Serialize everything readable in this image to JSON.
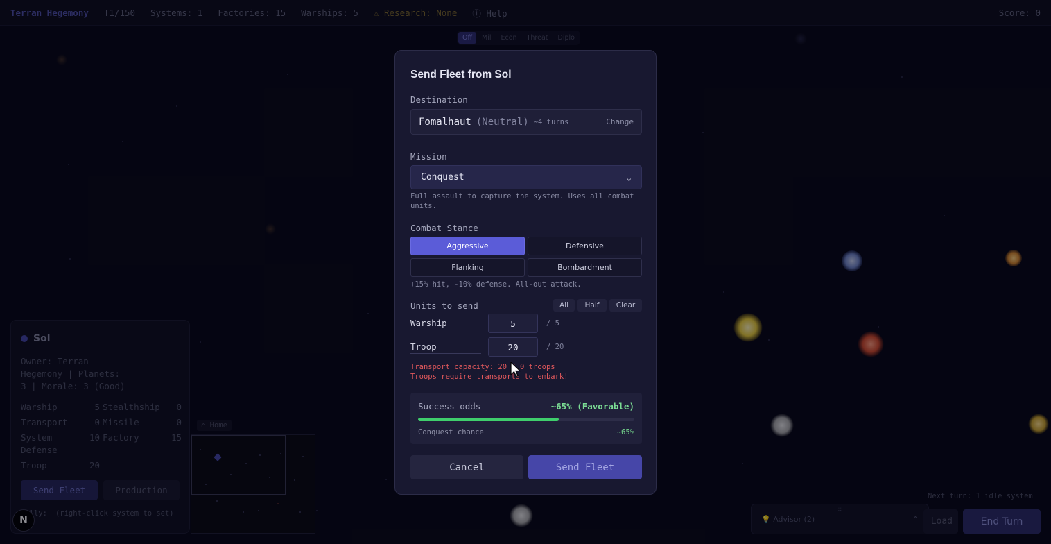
{
  "topbar": {
    "brand": "Terran Hegemony",
    "turn": "T1/150",
    "systems": "Systems: 1",
    "factories": "Factories: 15",
    "warships": "Warships: 5",
    "research": "⚠ Research: None",
    "help": "ⓘ Help",
    "score": "Score: 0"
  },
  "overlay_tabs": [
    "Off",
    "Mil",
    "Econ",
    "Threat",
    "Diplo"
  ],
  "system_panel": {
    "name": "Sol",
    "owner_line1": "Owner: Terran",
    "owner_line2": "Hegemony | Planets:",
    "owner_line3": "3 | Morale: 3 (Good)",
    "stats": [
      {
        "label": "Warship",
        "value": "5"
      },
      {
        "label": "Stealthship",
        "value": "0"
      },
      {
        "label": "Transport",
        "value": "0"
      },
      {
        "label": "Missile",
        "value": "0"
      },
      {
        "label": "System Defense",
        "value": "10"
      },
      {
        "label": "Factory",
        "value": "15"
      },
      {
        "label": "Troop",
        "value": "20"
      }
    ],
    "send_fleet": "Send Fleet",
    "production": "Production",
    "rally_label": "Rally:",
    "rally_value": "(right-click system to set)"
  },
  "minimap": {
    "home": "⌂ Home"
  },
  "bottom": {
    "next_turn": "Next turn: 1 idle system",
    "advisor": "💡 Advisor (2)",
    "load": "Load",
    "end_turn": "End Turn"
  },
  "modal": {
    "title": "Send Fleet from Sol",
    "destination_label": "Destination",
    "destination_name": "Fomalhaut",
    "destination_owner": "(Neutral)",
    "destination_turns": "~4 turns",
    "change": "Change",
    "mission_label": "Mission",
    "mission_value": "Conquest",
    "mission_desc": "Full assault to capture the system. Uses all combat units.",
    "stance_label": "Combat Stance",
    "stances": [
      "Aggressive",
      "Defensive",
      "Flanking",
      "Bombardment"
    ],
    "active_stance": "Aggressive",
    "stance_desc": "+15% hit, -10% defense. All-out attack.",
    "units_label": "Units to send",
    "quick": [
      "All",
      "Half",
      "Clear"
    ],
    "units": [
      {
        "name": "Warship",
        "value": "5",
        "max": "/ 5"
      },
      {
        "name": "Troop",
        "value": "20",
        "max": "/ 20"
      }
    ],
    "warning1": "Transport capacity: 20 / 0 troops",
    "warning2": "Troops require transports to embark!",
    "odds_label": "Success odds",
    "odds_value": "~65% (Favorable)",
    "odds_percent": 65,
    "chance_label": "Conquest chance",
    "chance_value": "~65%",
    "cancel": "Cancel",
    "send": "Send Fleet"
  },
  "colors": {
    "accent": "#5b5cd8",
    "success": "#3fce6c",
    "danger": "#e0585c"
  }
}
